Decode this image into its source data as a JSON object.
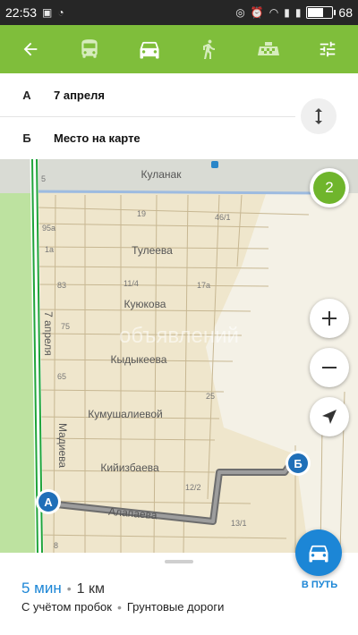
{
  "status": {
    "time": "22:53",
    "battery": "68",
    "battery_level": 0.68
  },
  "toolbar": {
    "back_icon": "back-arrow-icon",
    "modes": [
      "bus-icon",
      "car-icon",
      "walk-icon",
      "taxi-icon"
    ],
    "settings_icon": "settings-sliders-icon"
  },
  "route": {
    "from_letter": "А",
    "from_value": "7 апреля",
    "to_letter": "Б",
    "to_value": "Место на карте"
  },
  "map": {
    "streets": {
      "kulanak": "Куланак",
      "tuleeva": "Тулеева",
      "kuyukova": "Куюкова",
      "kydykeeva": "Кыдыкеева",
      "kumushalievoy": "Кумушалиевой",
      "kiyizbaeva": "Кийизбаева",
      "alapaeva": "Алапаева",
      "madieva": "Мадиева",
      "aprelya": "7 апреля"
    },
    "houses": [
      "19",
      "46/1",
      "95a",
      "1a",
      "83",
      "11/4",
      "17a",
      "75",
      "65",
      "25",
      "12/2",
      "13/1",
      "5",
      "8"
    ],
    "watermark": "объявлений",
    "marker_a": "А",
    "marker_b": "Б",
    "variants_count": "2"
  },
  "summary": {
    "time": "5 мин",
    "separator": "•",
    "distance": "1 км",
    "traffic": "С учётом пробок",
    "roads": "Грунтовые дороги"
  },
  "go_label": "В ПУТЬ",
  "colors": {
    "accent": "#7fbe3b",
    "blue": "#1c86d6",
    "map_bg": "#efe6cc"
  }
}
